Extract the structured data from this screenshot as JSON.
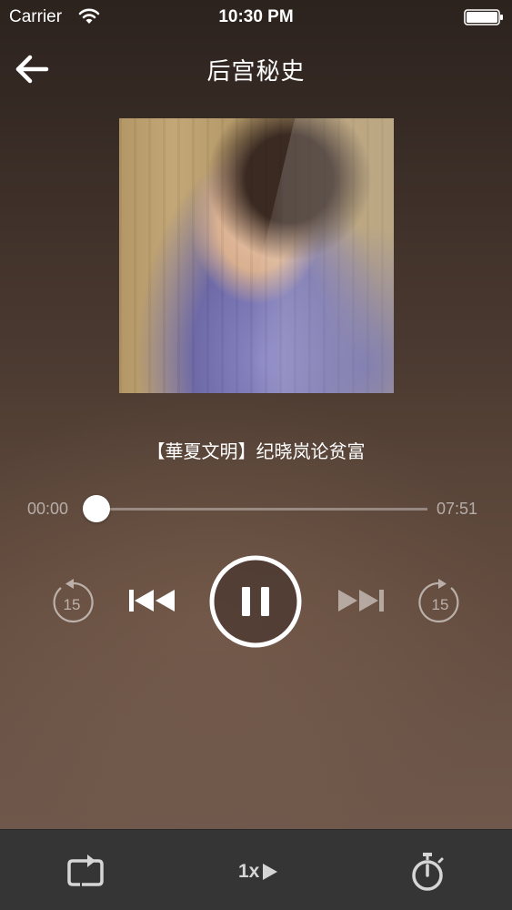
{
  "status_bar": {
    "carrier": "Carrier",
    "time": "10:30 PM"
  },
  "nav": {
    "title": "后宫秘史",
    "back_icon": "arrow-left-icon"
  },
  "track": {
    "title": "【華夏文明】纪晓岚论贫富"
  },
  "progress": {
    "elapsed": "00:00",
    "total": "07:51",
    "fraction": 0.0
  },
  "controls": {
    "rewind_seconds": "15",
    "forward_seconds": "15",
    "state": "playing"
  },
  "toolbar": {
    "speed_label": "1x",
    "repeat_icon": "repeat-icon",
    "timer_icon": "stopwatch-icon"
  },
  "colors": {
    "toolbar_bg": "#363536",
    "accent": "#ffffff"
  }
}
